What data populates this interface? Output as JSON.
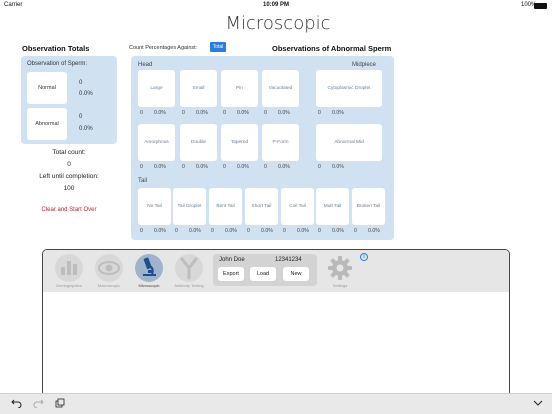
{
  "status": {
    "carrier": "Carrier",
    "time": "10:09 PM",
    "battery": "100%"
  },
  "page_title": "Microscopic",
  "totals": {
    "heading": "Observation Totals",
    "box_label": "Observation of Sperm:",
    "normal": {
      "label": "Normal",
      "count": "0",
      "pct": "0.0%"
    },
    "abnormal": {
      "label": "Abnormal",
      "count": "0",
      "pct": "0.0%"
    },
    "total_count_label": "Total count:",
    "total_count": "0",
    "left_label": "Left until completion:",
    "left_value": "100",
    "clear_label": "Clear and Start Over"
  },
  "count_against": {
    "label": "Count Percentages Against:",
    "button": "Total"
  },
  "abnormal": {
    "heading": "Observations of Abnormal Sperm",
    "head_label": "Head",
    "midpiece_label": "Midpiece",
    "tail_label": "Tail",
    "head_row1": [
      {
        "label": "Large",
        "count": "0",
        "pct": "0.0%"
      },
      {
        "label": "Small",
        "count": "0",
        "pct": "0.0%"
      },
      {
        "label": "Pin",
        "count": "0",
        "pct": "0.0%"
      },
      {
        "label": "Vacuolated",
        "count": "0",
        "pct": "0.0%"
      }
    ],
    "mid_row1": {
      "label": "Cytoplasmic Droplet",
      "count": "0",
      "pct": "0.0%"
    },
    "head_row2": [
      {
        "label": "Amorphous",
        "count": "0",
        "pct": "0.0%"
      },
      {
        "label": "Double",
        "count": "0",
        "pct": "0.0%"
      },
      {
        "label": "Tapered",
        "count": "0",
        "pct": "0.0%"
      },
      {
        "label": "P-Form",
        "count": "0",
        "pct": "0.0%"
      }
    ],
    "mid_row2": {
      "label": "Abnormal Mid",
      "count": "0",
      "pct": "0.0%"
    },
    "tail": [
      {
        "label": "No Tail",
        "count": "0",
        "pct": "0.0%"
      },
      {
        "label": "Tail Droplet",
        "count": "0",
        "pct": "0.0%"
      },
      {
        "label": "Bent Tail",
        "count": "0",
        "pct": "0.0%"
      },
      {
        "label": "Short Tail",
        "count": "0",
        "pct": "0.0%"
      },
      {
        "label": "Coil Tail",
        "count": "0",
        "pct": "0.0%"
      },
      {
        "label": "Mult Tail",
        "count": "0",
        "pct": "0.0%"
      },
      {
        "label": "Broken Tail",
        "count": "0",
        "pct": "0.0%"
      }
    ]
  },
  "toolbar": {
    "items": [
      {
        "label": "Demographics",
        "icon": "bar-chart-icon"
      },
      {
        "label": "Macroscopic",
        "icon": "eye-icon"
      },
      {
        "label": "Microscopic",
        "icon": "microscope-icon"
      },
      {
        "label": "Antibody Testing",
        "icon": "antibody-icon"
      }
    ],
    "settings_label": "Settings",
    "info": "i"
  },
  "patient": {
    "name": "John Doe",
    "id": "12341234",
    "export": "Export",
    "load": "Load",
    "new": "New"
  },
  "colors": {
    "accent": "#2b7ee0",
    "panel": "#d0e2f2",
    "clear": "#b8232c"
  }
}
